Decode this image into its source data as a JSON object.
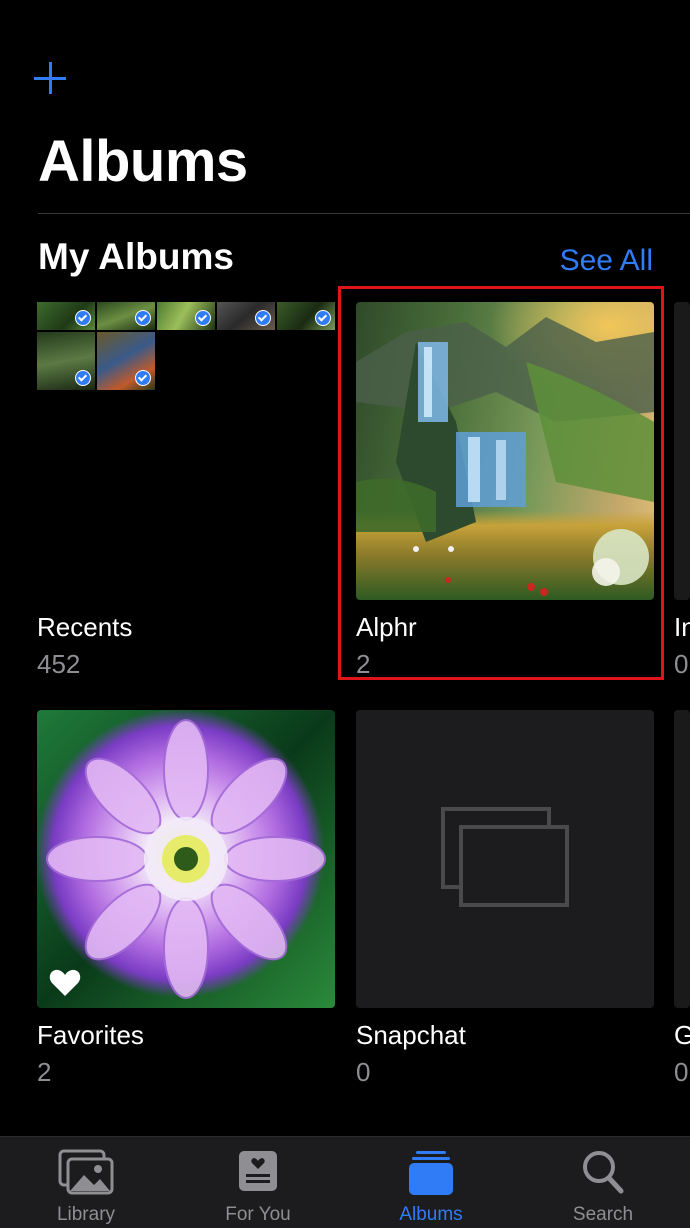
{
  "header": {
    "add_icon": "plus-icon",
    "title": "Albums"
  },
  "section": {
    "title": "My Albums",
    "see_all": "See All"
  },
  "albums": [
    {
      "name": "Recents",
      "count": "452"
    },
    {
      "name": "Alphr",
      "count": "2"
    },
    {
      "name": "In",
      "count": "0"
    },
    {
      "name": "Favorites",
      "count": "2"
    },
    {
      "name": "Snapchat",
      "count": "0"
    },
    {
      "name": "G",
      "count": "0"
    }
  ],
  "tabs": [
    {
      "label": "Library",
      "icon": "photo-library-icon",
      "active": false
    },
    {
      "label": "For You",
      "icon": "for-you-icon",
      "active": false
    },
    {
      "label": "Albums",
      "icon": "albums-icon",
      "active": true
    },
    {
      "label": "Search",
      "icon": "search-icon",
      "active": false
    }
  ],
  "colors": {
    "accent": "#2f7cf6",
    "selection": "#e1141b",
    "background": "#000000"
  }
}
